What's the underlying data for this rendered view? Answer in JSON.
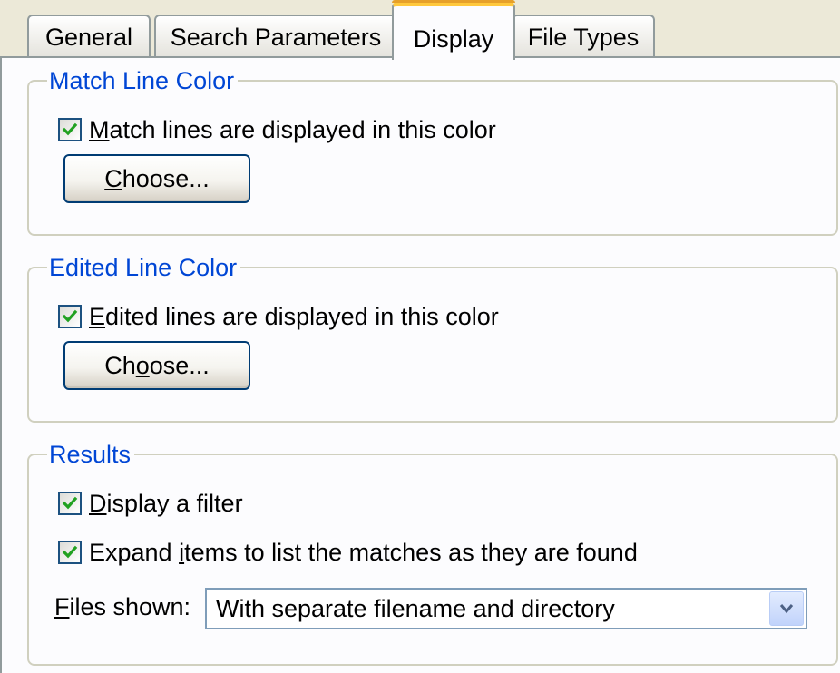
{
  "tabs": [
    {
      "label": "General",
      "active": false
    },
    {
      "label": "Search Parameters",
      "active": false
    },
    {
      "label": "Display",
      "active": true
    },
    {
      "label": "File Types",
      "active": false
    }
  ],
  "match_group": {
    "title": "Match Line Color",
    "checkbox": {
      "label_mnemonic": "M",
      "label_rest": "atch lines are displayed in this color",
      "checked": true
    },
    "button": {
      "label_mnemonic": "C",
      "label_rest": "hoose..."
    }
  },
  "edited_group": {
    "title": "Edited Line Color",
    "checkbox": {
      "label_mnemonic": "E",
      "label_rest": "dited lines are displayed in this color",
      "checked": true
    },
    "button": {
      "label_pre": "Ch",
      "label_mnemonic": "o",
      "label_rest": "ose..."
    }
  },
  "results_group": {
    "title": "Results",
    "filter_checkbox": {
      "label_mnemonic": "D",
      "label_rest": "isplay a filter",
      "checked": true
    },
    "expand_checkbox": {
      "label_pre": "Expand ",
      "label_mnemonic": "i",
      "label_rest": "tems to list the matches as they are found",
      "checked": true
    },
    "files_shown": {
      "label_mnemonic": "F",
      "label_rest": "iles shown:",
      "selected": "With separate filename and directory"
    }
  },
  "colors": {
    "group_title": "#0046d5",
    "active_tab_highlight": "#ffc83c",
    "check_mark": "#21a121",
    "panel_background": "#fcfcfe",
    "dialog_background": "#ece9d8"
  }
}
